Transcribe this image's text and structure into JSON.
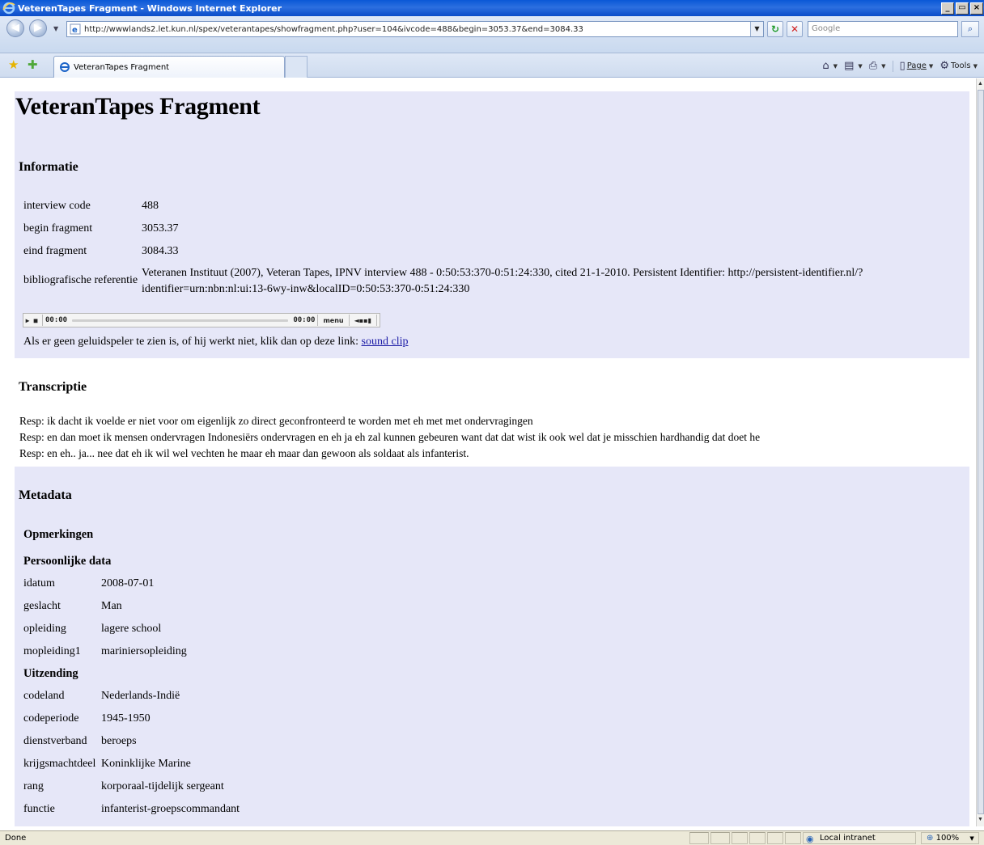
{
  "window": {
    "title": "VeterenTapes Fragment - Windows Internet Explorer",
    "min_glyph": "_",
    "max_glyph": "▭",
    "close_glyph": "×"
  },
  "nav": {
    "url": "http://wwwlands2.let.kun.nl/spex/veterantapes/showfragment.php?user=104&ivcode=488&begin=3053.37&end=3084.33",
    "search_placeholder": "Google",
    "refresh_glyph": "↻",
    "stop_glyph": "✕"
  },
  "tabs": {
    "active_label": "VeteranTapes Fragment"
  },
  "commandbar": {
    "page_label": "Page",
    "tools_label": "Tools"
  },
  "page": {
    "title": "VeteranTapes Fragment",
    "info_heading": "Informatie",
    "info": {
      "interview_code_label": "interview code",
      "interview_code_value": "488",
      "begin_label": "begin fragment",
      "begin_value": "3053.37",
      "end_label": "eind fragment",
      "end_value": "3084.33",
      "ref_label": "bibliografische referentie",
      "ref_line1": "Veteranen Instituut (2007), Veteran Tapes, IPNV interview 488 - 0:50:53:370-0:51:24:330, cited 21-1-2010. Persistent Identifier: http://persistent-identifier.nl/?",
      "ref_line2": "identifier=urn:nbn:nl:ui:13-6wy-inw&localID=0:50:53:370-0:51:24:330"
    },
    "player": {
      "time_left": "00:00",
      "time_right": "00:00",
      "menu_label": "menu"
    },
    "fallback_text": "Als er geen geluidspeler te zien is, of hij werkt niet, klik dan op deze link:",
    "fallback_link": "sound clip",
    "transcript_heading": "Transcriptie",
    "transcript": [
      "Resp: ik dacht ik voelde er niet voor om eigenlijk zo direct geconfronteerd te worden met eh met met ondervragingen",
      "Resp: en dan moet ik mensen ondervragen Indonesiërs ondervragen en eh ja eh zal kunnen gebeuren want dat dat wist ik ook wel dat je misschien hardhandig dat doet he",
      "Resp: en eh.. ja... nee dat eh ik wil wel vechten he maar eh maar dan gewoon als soldaat als infanterist."
    ],
    "metadata_heading": "Metadata",
    "remarks_heading": "Opmerkingen",
    "personal_heading": "Persoonlijke data",
    "personal": [
      {
        "label": "idatum",
        "value": "2008-07-01"
      },
      {
        "label": "geslacht",
        "value": "Man"
      },
      {
        "label": "opleiding",
        "value": "lagere school"
      },
      {
        "label": "mopleiding1",
        "value": "mariniersopleiding"
      }
    ],
    "deployment_heading": "Uitzending",
    "deployment": [
      {
        "label": "codeland",
        "value": "Nederlands-Indië"
      },
      {
        "label": "codeperiode",
        "value": "1945-1950"
      },
      {
        "label": "dienstverband",
        "value": "beroeps"
      },
      {
        "label": "krijgsmachtdeel",
        "value": "Koninklijke Marine"
      },
      {
        "label": "rang",
        "value": "korporaal-tijdelijk sergeant"
      },
      {
        "label": "functie",
        "value": "infanterist-groepscommandant"
      }
    ]
  },
  "status": {
    "text": "Done",
    "zone": "Local intranet",
    "zoom": "100%"
  },
  "colors": {
    "panel_bg": "#e6e7f8",
    "link": "#1a1aa6",
    "titlebar": "#0a58d6"
  }
}
